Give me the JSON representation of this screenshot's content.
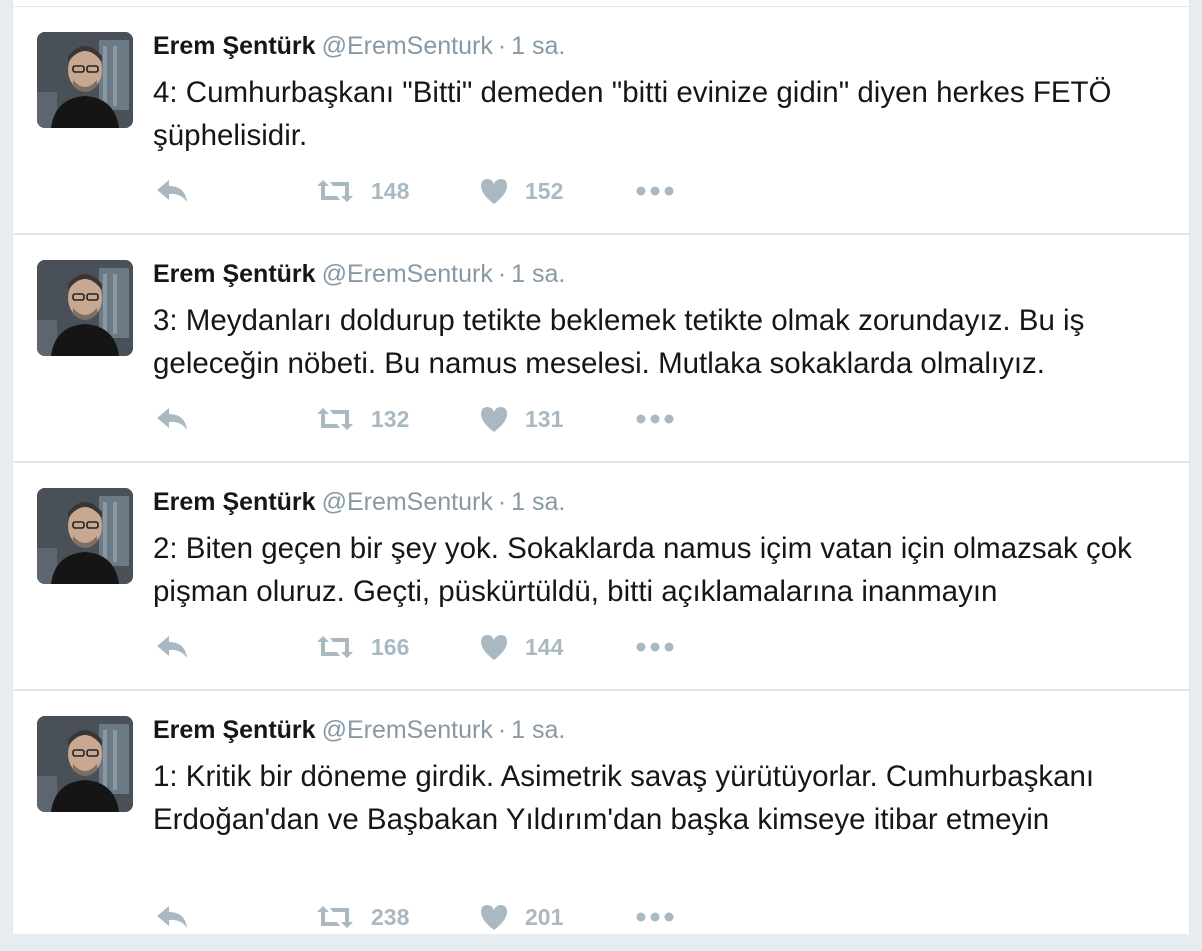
{
  "tweets": [
    {
      "fullname": "Erem Şentürk",
      "username": "@EremSenturk",
      "separator": "·",
      "time": "1 sa.",
      "text": "4: Cumhurbaşkanı \"Bitti\" demeden \"bitti evinize gidin\" diyen herkes FETÖ şüphelisidir.",
      "retweets": "148",
      "likes": "152"
    },
    {
      "fullname": "Erem Şentürk",
      "username": "@EremSenturk",
      "separator": "·",
      "time": "1 sa.",
      "text": "3: Meydanları doldurup tetikte beklemek tetikte olmak zorundayız. Bu iş geleceğin nöbeti. Bu namus meselesi. Mutlaka sokaklarda olmalıyız.",
      "retweets": "132",
      "likes": "131"
    },
    {
      "fullname": "Erem Şentürk",
      "username": "@EremSenturk",
      "separator": "·",
      "time": "1 sa.",
      "text": "2: Biten geçen bir şey yok. Sokaklarda namus içim vatan için olmazsak çok pişman oluruz. Geçti, püskürtüldü, bitti açıklamalarına inanmayın",
      "retweets": "166",
      "likes": "144"
    },
    {
      "fullname": "Erem Şentürk",
      "username": "@EremSenturk",
      "separator": "·",
      "time": "1 sa.",
      "text": "1: Kritik bir döneme girdik. Asimetrik savaş yürütüyorlar. Cumhurbaşkanı Erdoğan'dan ve Başbakan Yıldırım'dan başka kimseye itibar etmeyin",
      "retweets": "238",
      "likes": "201"
    }
  ],
  "icons": {
    "reply": "reply-icon",
    "retweet": "retweet-icon",
    "like": "heart-icon",
    "more": "more-dots-icon"
  },
  "colors": {
    "action_gray": "#aab8c2",
    "meta_gray": "#8899a6",
    "text": "#14171a",
    "divider": "#e1e8ed"
  }
}
